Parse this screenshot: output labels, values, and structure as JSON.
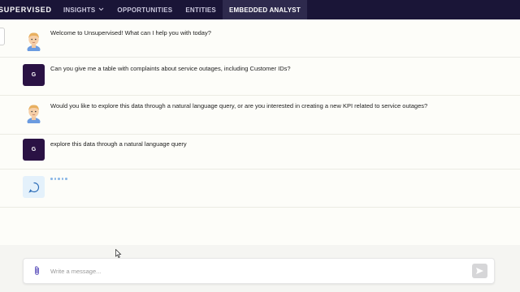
{
  "nav": {
    "brand": "SUPERVISED",
    "items": [
      {
        "label": "INSIGHTS",
        "chevron": "chevron-down-icon"
      },
      {
        "label": "OPPORTUNITIES"
      },
      {
        "label": "ENTITIES"
      },
      {
        "label": "EMBEDDED ANALYST",
        "active": true
      }
    ]
  },
  "messages": [
    {
      "sender": "bot",
      "text": "Welcome to Unsupervised! What can I help you with today?"
    },
    {
      "sender": "user",
      "initial": "G",
      "text": "Can you give me a table with complaints about service outages, including Customer IDs?"
    },
    {
      "sender": "bot",
      "text": "Would you like to explore this data through a natural language query, or are you interested in creating a new KPI related to service outages?"
    },
    {
      "sender": "user",
      "initial": "G",
      "text": "explore this data through a natural language query"
    }
  ],
  "composer": {
    "placeholder": "Write a message...",
    "attach_icon": "paperclip-icon",
    "send_icon": "send-icon"
  },
  "colors": {
    "nav_bg": "#1a1537",
    "nav_active_bg": "#2e2a4d",
    "user_avatar_bg": "#2a1244",
    "loading_dots": "#8cb8e6"
  }
}
